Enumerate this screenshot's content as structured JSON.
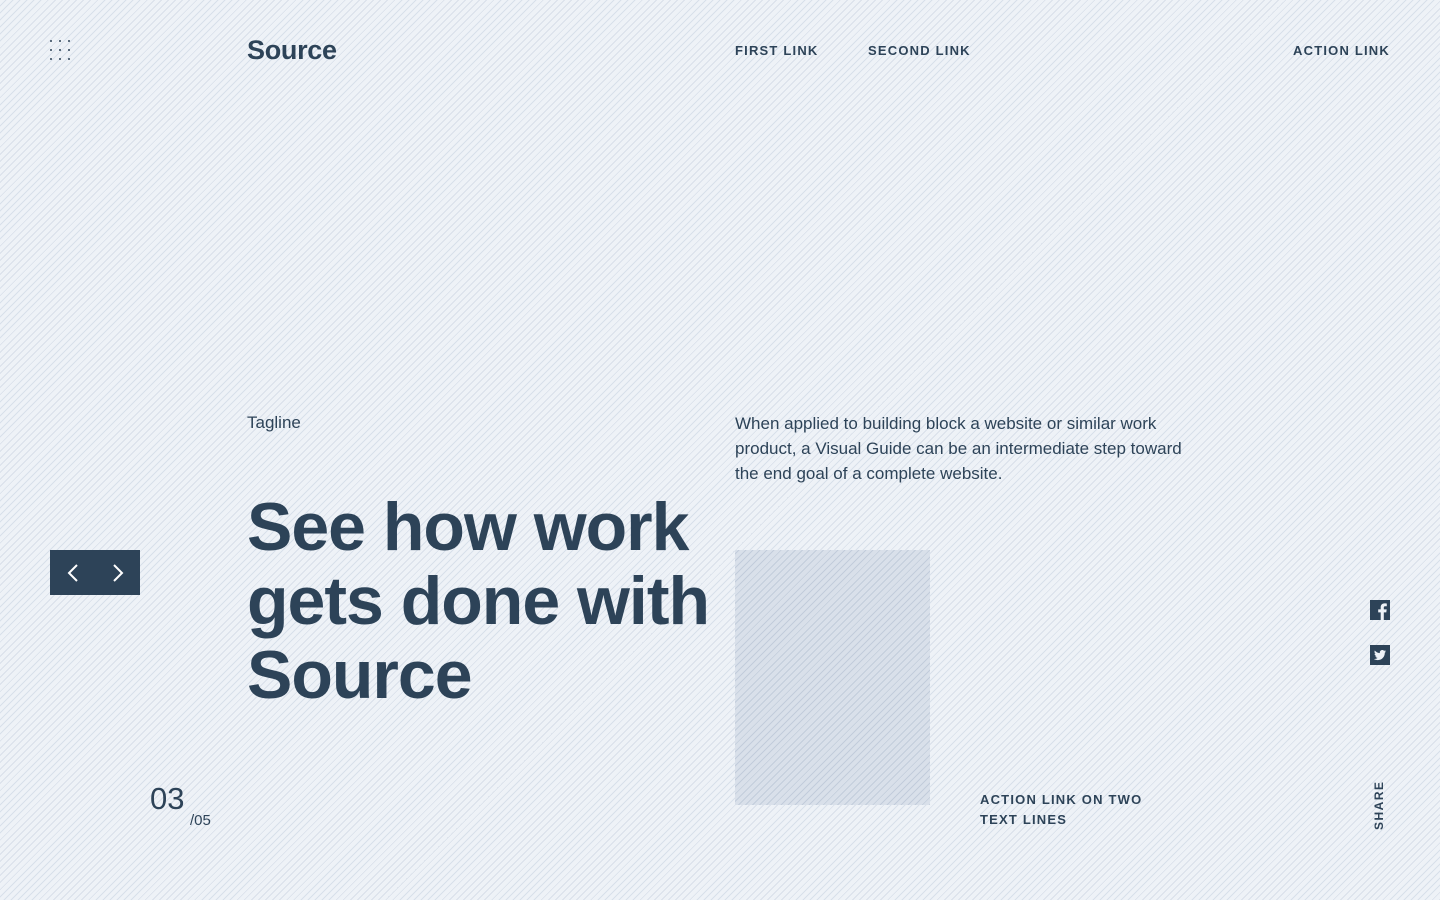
{
  "header": {
    "logo": "Source",
    "nav": {
      "first_link": "FIRST LINK",
      "second_link": "SECOND LINK",
      "action_link": "ACTION LINK"
    },
    "menu_icon": "grid-dots-icon"
  },
  "hero": {
    "tagline": "Tagline",
    "headline": "See how work gets done with Source",
    "description": "When applied to building block a website or similar work product, a Visual Guide can be an intermediate step toward the end goal of a complete website.",
    "action_link_two_lines": "ACTION LINK ON TWO TEXT LINES"
  },
  "slider": {
    "prev_icon": "chevron-left-icon",
    "next_icon": "chevron-right-icon",
    "current": "03",
    "total": "/05"
  },
  "social": {
    "share_label": "SHARE",
    "icons": [
      "facebook-icon",
      "twitter-icon"
    ]
  },
  "colors": {
    "primary": "#2d4358",
    "background": "#eef2f7",
    "image_placeholder": "#d9e0ea"
  }
}
